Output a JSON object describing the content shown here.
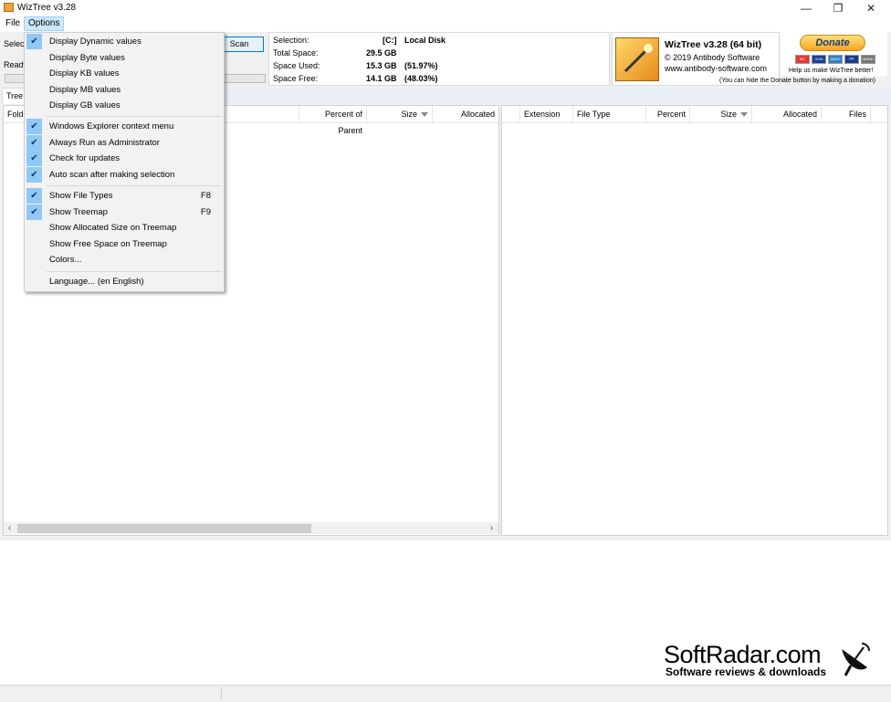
{
  "window": {
    "title": "WizTree v3.28",
    "controls": [
      "—",
      "❐",
      "✕"
    ]
  },
  "menu": {
    "items": [
      "File",
      "Options"
    ],
    "active": "Options"
  },
  "toolbar": {
    "select_label": "Select",
    "status": "Ready",
    "scan_label": "Scan"
  },
  "disk_info": {
    "selection_label": "Selection:",
    "drive": "[C:]",
    "drive_name": "Local Disk",
    "total_space_label": "Total Space:",
    "total_space": "29.5 GB",
    "space_used_label": "Space Used:",
    "space_used": "15.3 GB",
    "space_used_pct": "(51.97%)",
    "space_free_label": "Space Free:",
    "space_free": "14.1 GB",
    "space_free_pct": "(48.03%)"
  },
  "about": {
    "title": "WizTree v3.28 (64 bit)",
    "copyright": "© 2019 Antibody Software",
    "url": "www.antibody-software.com"
  },
  "donate": {
    "button": "Donate",
    "cards": [
      "MC",
      "VISA",
      "AMEX",
      "PP",
      "BANK"
    ],
    "caption": "Help us make WizTree better!",
    "note": "(You can hide the Donate button by making a donation)"
  },
  "tabs": {
    "tree": "Tree"
  },
  "tree_columns": {
    "folder": "Fold",
    "percent": "Percent of Parent",
    "size": "Size",
    "allocated": "Allocated"
  },
  "ext_columns": {
    "extension": "Extension",
    "file_type": "File Type",
    "percent": "Percent",
    "size": "Size",
    "allocated": "Allocated",
    "files": "Files"
  },
  "options_menu": {
    "items": [
      {
        "label": "Display Dynamic values",
        "checked": true,
        "shortcut": ""
      },
      {
        "label": "Display Byte values",
        "checked": false,
        "shortcut": ""
      },
      {
        "label": "Display KB values",
        "checked": false,
        "shortcut": ""
      },
      {
        "label": "Display MB values",
        "checked": false,
        "shortcut": ""
      },
      {
        "label": "Display GB values",
        "checked": false,
        "shortcut": ""
      },
      {
        "label": "Windows Explorer context menu",
        "checked": true,
        "shortcut": ""
      },
      {
        "label": "Always Run as Administrator",
        "checked": true,
        "shortcut": ""
      },
      {
        "label": "Check for updates",
        "checked": true,
        "shortcut": ""
      },
      {
        "label": "Auto scan after making selection",
        "checked": true,
        "shortcut": ""
      },
      {
        "label": "Show File Types",
        "checked": true,
        "shortcut": "F8"
      },
      {
        "label": "Show Treemap",
        "checked": true,
        "shortcut": "F9"
      },
      {
        "label": "Show Allocated Size on Treemap",
        "checked": false,
        "shortcut": ""
      },
      {
        "label": "Show Free Space on Treemap",
        "checked": false,
        "shortcut": ""
      },
      {
        "label": "Colors...",
        "checked": false,
        "shortcut": ""
      },
      {
        "label": "Language... (en English)",
        "checked": false,
        "shortcut": ""
      }
    ]
  },
  "watermark": {
    "brand": "SoftRadar.com",
    "tagline": "Software reviews & downloads"
  }
}
